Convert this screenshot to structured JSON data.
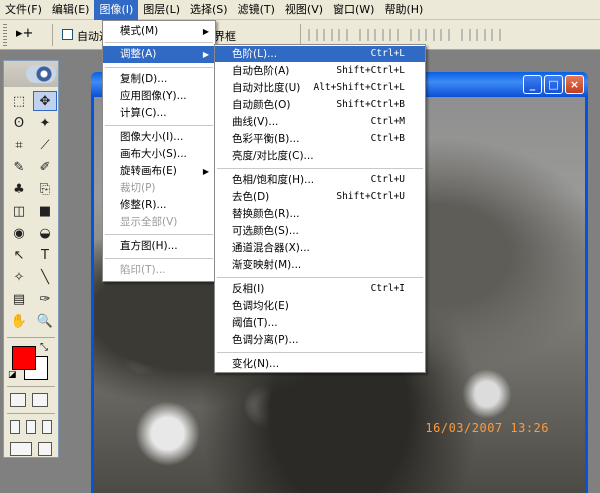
{
  "menubar": {
    "items": [
      "文件(F)",
      "编辑(E)",
      "图像(I)",
      "图层(L)",
      "选择(S)",
      "滤镜(T)",
      "视图(V)",
      "窗口(W)",
      "帮助(H)"
    ],
    "active_index": 2
  },
  "options_bar": {
    "tool_glyph": "▸+",
    "auto_select_label": "自动选",
    "transform_label": "定界框"
  },
  "image_menu": {
    "items": [
      {
        "label": "模式(M)",
        "submenu": true
      },
      {
        "label": "调整(A)",
        "submenu": true,
        "highlighted": true
      },
      {
        "label": "复制(D)..."
      },
      {
        "label": "应用图像(Y)..."
      },
      {
        "label": "计算(C)..."
      },
      {
        "label": "图像大小(I)..."
      },
      {
        "label": "画布大小(S)..."
      },
      {
        "label": "旋转画布(E)",
        "submenu": true
      },
      {
        "label": "裁切(P)",
        "disabled": true
      },
      {
        "label": "修整(R)..."
      },
      {
        "label": "显示全部(V)",
        "disabled": true
      },
      {
        "label": "直方图(H)..."
      },
      {
        "label": "陷印(T)...",
        "disabled": true
      }
    ]
  },
  "adjust_menu": {
    "items": [
      {
        "label": "色阶(L)...",
        "shortcut": "Ctrl+L",
        "highlighted": true
      },
      {
        "label": "自动色阶(A)",
        "shortcut": "Shift+Ctrl+L"
      },
      {
        "label": "自动对比度(U)",
        "shortcut": "Alt+Shift+Ctrl+L"
      },
      {
        "label": "自动颜色(O)",
        "shortcut": "Shift+Ctrl+B"
      },
      {
        "label": "曲线(V)...",
        "shortcut": "Ctrl+M"
      },
      {
        "label": "色彩平衡(B)...",
        "shortcut": "Ctrl+B"
      },
      {
        "label": "亮度/对比度(C)...",
        "shortcut": ""
      },
      {
        "label": "色相/饱和度(H)...",
        "shortcut": "Ctrl+U"
      },
      {
        "label": "去色(D)",
        "shortcut": "Shift+Ctrl+U"
      },
      {
        "label": "替换颜色(R)...",
        "shortcut": ""
      },
      {
        "label": "可选颜色(S)...",
        "shortcut": ""
      },
      {
        "label": "通道混合器(X)...",
        "shortcut": ""
      },
      {
        "label": "渐变映射(M)...",
        "shortcut": ""
      },
      {
        "label": "反相(I)",
        "shortcut": "Ctrl+I"
      },
      {
        "label": "色调均化(E)",
        "shortcut": ""
      },
      {
        "label": "阈值(T)...",
        "shortcut": ""
      },
      {
        "label": "色调分离(P)...",
        "shortcut": ""
      },
      {
        "label": "变化(N)...",
        "shortcut": ""
      }
    ]
  },
  "document": {
    "date_stamp": "16/03/2007 13:26",
    "window_buttons": [
      "_",
      "□",
      "×"
    ]
  },
  "toolbox": {
    "tools": [
      "⬚",
      "✥",
      "ʘ",
      "✦",
      "⌗",
      "⟋",
      "✎",
      "✐",
      "♣",
      "⎘",
      "◫",
      "■",
      "◉",
      "◒",
      "↖",
      "T",
      "✧",
      "╲",
      "▤",
      "✑",
      "✋",
      "🔍"
    ],
    "foreground_color": "#ff0000",
    "background_color": "#ffffff"
  },
  "colors": {
    "menu_highlight": "#316ac5",
    "title_bar": "#0054e3"
  }
}
